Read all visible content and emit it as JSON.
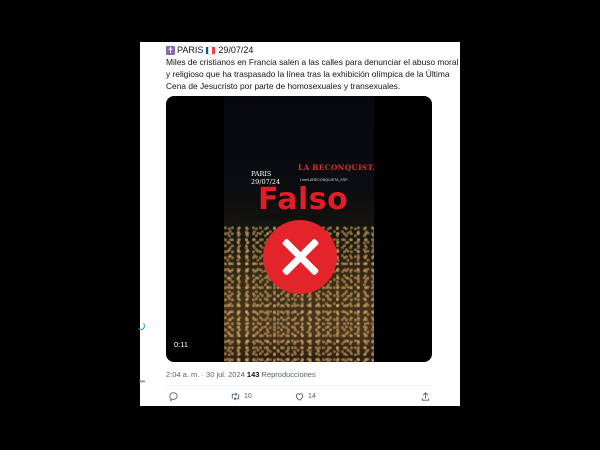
{
  "tweet": {
    "header_location": "PARIS",
    "header_date": "29/07/24",
    "text": "Miles de cristianos en Francia salen a las calles para denunciar el abuso moral y religioso que ha traspasado la línea tras la exhibición olímpica de la Última Cena de Jesucristo por parte de homosexuales y transexuales.",
    "time": "2:04 a. m.",
    "separator": " · ",
    "date": "30 jul. 2024",
    "views_count": "143",
    "views_label": "Reproducciones"
  },
  "video": {
    "overlay_location": "PARIS",
    "overlay_date": "29/07/24",
    "brand": "LA RECONQUISTA",
    "handle": "t.me/LARECONQUISTA_ESP",
    "verdict": "Falso",
    "duration": "0:11"
  },
  "actions": {
    "retweets": "10",
    "likes": "14"
  },
  "colors": {
    "verdict_red": "#e21d24",
    "flag_blue": "#0055a4",
    "flag_red": "#ef4135",
    "meta_gray": "#536471"
  },
  "icons": [
    "cross-icon",
    "france-flag-icon",
    "reply-icon",
    "retweet-icon",
    "like-icon",
    "share-icon",
    "more-icon"
  ]
}
